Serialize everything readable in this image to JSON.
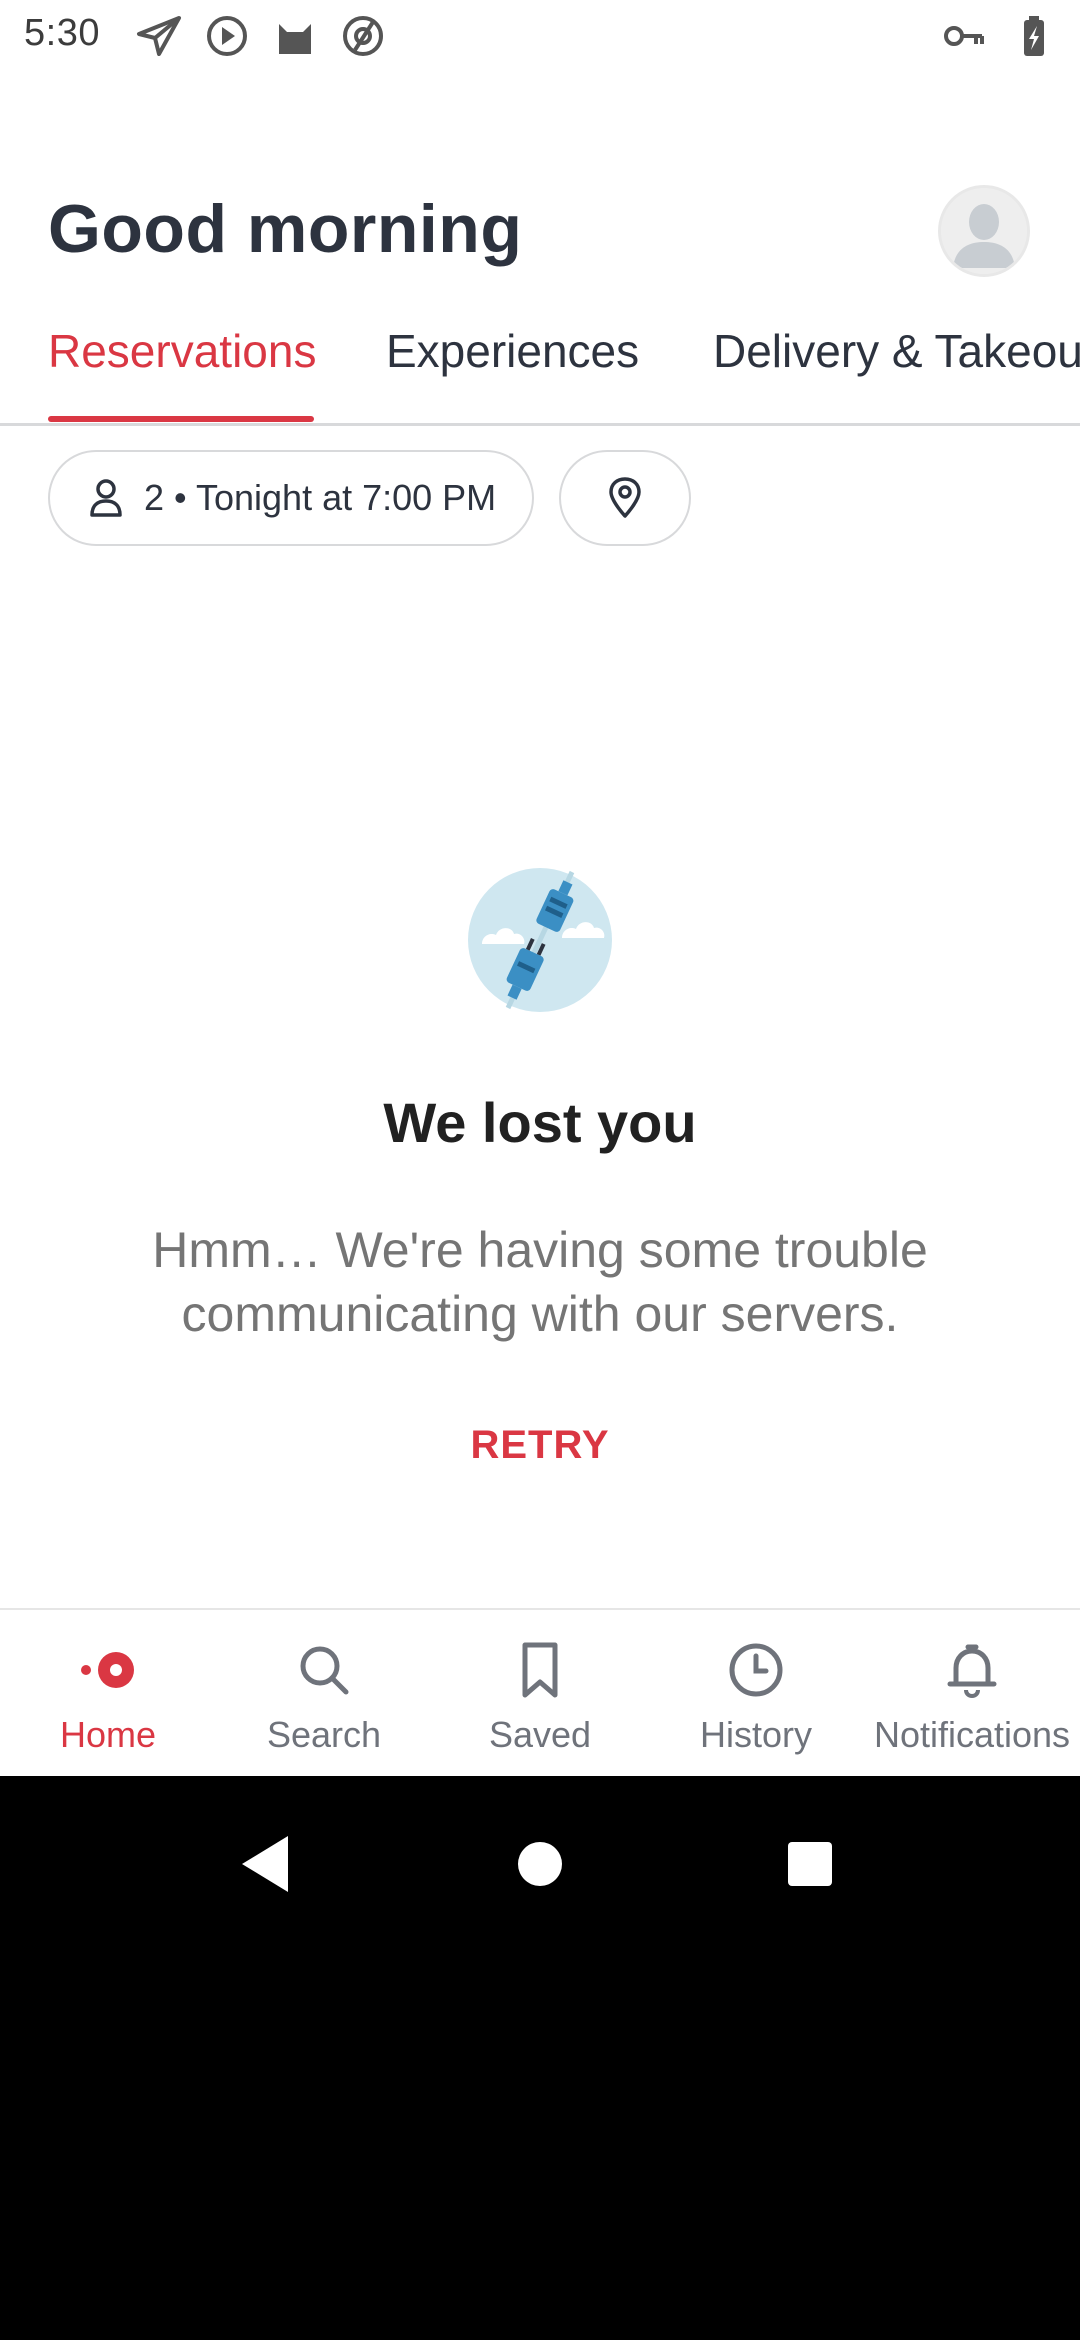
{
  "status_bar": {
    "time": "5:30",
    "left_icons": [
      "send-icon",
      "play-circle-icon",
      "cat-icon",
      "at-sign-icon"
    ],
    "right_icons": [
      "vpn-key-icon",
      "battery-charging-icon"
    ]
  },
  "header": {
    "greeting": "Good morning",
    "avatar_icon": "profile-avatar-icon"
  },
  "tabs": [
    {
      "label": "Reservations",
      "active": true
    },
    {
      "label": "Experiences",
      "active": false
    },
    {
      "label": "Delivery & Takeout",
      "active": false
    }
  ],
  "filters": {
    "party_summary": "2 • Tonight at 7:00 PM",
    "party_icon": "person-icon",
    "location_icon": "map-pin-icon"
  },
  "error": {
    "illustration_icon": "disconnected-plug-icon",
    "title": "We lost you",
    "message": "Hmm… We're having some trouble communicating with our servers.",
    "retry_label": "RETRY"
  },
  "bottom_nav": [
    {
      "label": "Home",
      "icon": "home-dot-icon",
      "active": true
    },
    {
      "label": "Search",
      "icon": "search-icon",
      "active": false
    },
    {
      "label": "Saved",
      "icon": "bookmark-icon",
      "active": false
    },
    {
      "label": "History",
      "icon": "clock-icon",
      "active": false
    },
    {
      "label": "Notifications",
      "icon": "bell-icon",
      "active": false
    }
  ],
  "colors": {
    "accent": "#da3743",
    "text_dark": "#2d333f",
    "text_muted": "#757575",
    "nav_inactive": "#6f737b"
  }
}
